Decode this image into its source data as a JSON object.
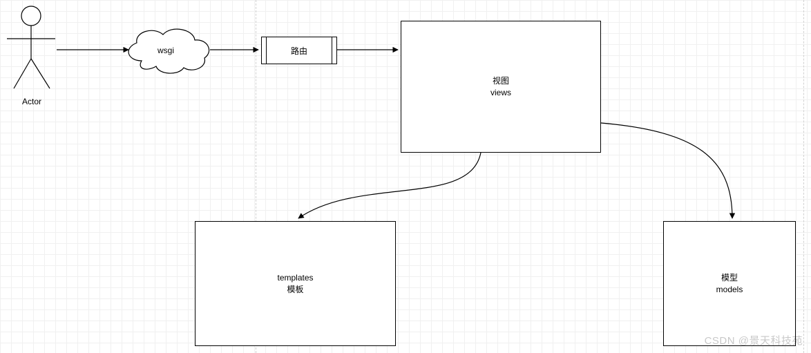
{
  "nodes": {
    "actor": {
      "label": "Actor"
    },
    "wsgi": {
      "label": "wsgi"
    },
    "router": {
      "label": "路由"
    },
    "views": {
      "line1": "视图",
      "line2": "views"
    },
    "templates": {
      "line1": "templates",
      "line2": "模板"
    },
    "models": {
      "line1": "模型",
      "line2": "models"
    }
  },
  "watermark": "CSDN @景天科技苑"
}
